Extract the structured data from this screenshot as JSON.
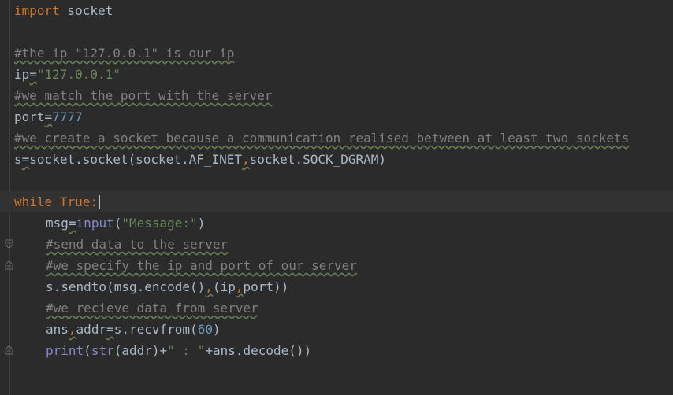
{
  "code": {
    "l1": {
      "kw": "import",
      "rest": " socket"
    },
    "l3": {
      "comment": "#the ip \"127.0.0.1\" is our ip"
    },
    "l4": {
      "name": "ip",
      "eq": "=",
      "value": "\"127.0.0.1\""
    },
    "l5": {
      "comment": "#we match the port with the server"
    },
    "l6": {
      "name": "port",
      "eq": "=",
      "value": "7777"
    },
    "l7": {
      "comment": "#we create a socket because a communication realised between at least two sockets"
    },
    "l8": {
      "name": "s",
      "eq": "=",
      "call": "socket.socket(socket.AF_INET",
      "comma": ",",
      "arg2": "socket.SOCK_DGRAM)"
    },
    "l10": {
      "kw1": "while",
      "kw2": " True",
      "colon": ":"
    },
    "l11": {
      "name": "msg",
      "eq": "=",
      "fn": "input",
      "open": "(",
      "str": "\"Message:\"",
      "close": ")"
    },
    "l12": {
      "comment": "#send data to the server"
    },
    "l13": {
      "comment": "#we specify the ip and port of our server"
    },
    "l14": {
      "pre": "s.sendto(msg.encode()",
      "c1": ",",
      "mid": "(ip",
      "c2": ",",
      "post": "port))"
    },
    "l15": {
      "comment": "#we recieve data from server"
    },
    "l16": {
      "a": "ans",
      "comma": ",",
      "b": "addr",
      "eq": "=",
      "call": "s.recvfrom(",
      "num": "60",
      "close": ")"
    },
    "l17": {
      "fn1": "print",
      "open": "(",
      "fn2": "str",
      "mid": "(addr)+",
      "str": "\" : \"",
      "post": "+ans.decode())"
    }
  }
}
